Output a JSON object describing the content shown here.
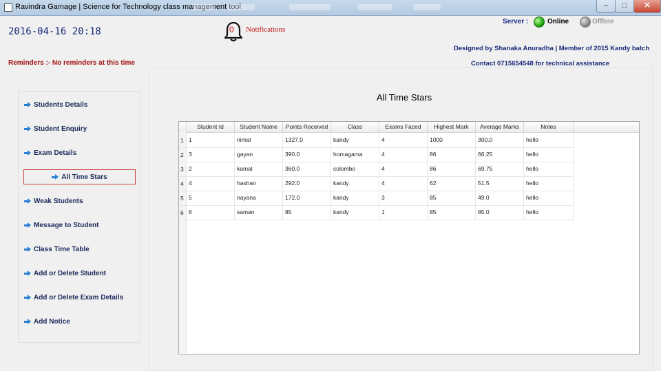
{
  "window": {
    "title": "Ravindra Gamage | Science for Technology class management tool",
    "min": "–",
    "max": "□",
    "close": "✕"
  },
  "header": {
    "datetime": "2016-04-16 20:18",
    "notifications": {
      "count": "0",
      "label": "Notifications",
      "icon": "bell-icon"
    },
    "server": {
      "label": "Server :",
      "online": "Online",
      "offline": "Offline",
      "state": "online",
      "online_color": "#22a80e",
      "offline_color": "#8c8c8c"
    },
    "designed_by": "Designed by Shanaka Anuradha | Member of 2015 Kandy  batch",
    "contact": "Contact 0715654548 for technical assistance",
    "reminders": "Reminders :- No reminders at this time"
  },
  "sidebar": {
    "items": [
      {
        "label": "Students Details"
      },
      {
        "label": "Student Enquiry"
      },
      {
        "label": "Exam Details"
      },
      {
        "label": "All Time Stars",
        "active": true
      },
      {
        "label": "Weak Students"
      },
      {
        "label": "Message to Student"
      },
      {
        "label": "Class Time Table"
      },
      {
        "label": "Add or Delete Student"
      },
      {
        "label": "Add or Delete Exam Details"
      },
      {
        "label": "Add Notice"
      }
    ]
  },
  "main": {
    "title": "All Time Stars",
    "table": {
      "columns": [
        "Student Id",
        "Student Name",
        "Points Received",
        "Class",
        "Exams Faced",
        "Highest Mark",
        "Average Marks",
        "Notes"
      ],
      "rows": [
        {
          "n": "1",
          "cells": [
            "1",
            "nimal",
            "1327.0",
            "kandy",
            "4",
            "1000",
            "300.0",
            "hello"
          ]
        },
        {
          "n": "2",
          "cells": [
            "3",
            "gayan",
            "390.0",
            "homagama",
            "4",
            "86",
            "66.25",
            "hello"
          ]
        },
        {
          "n": "3",
          "cells": [
            "2",
            "kamal",
            "360.0",
            "colombo",
            "4",
            "86",
            "69.75",
            "hello"
          ]
        },
        {
          "n": "4",
          "cells": [
            "4",
            "hashan",
            "292.0",
            "kandy",
            "4",
            "62",
            "51.5",
            "hello"
          ]
        },
        {
          "n": "5",
          "cells": [
            "5",
            "nayana",
            "172.0",
            "kandy",
            "3",
            "85",
            "49.0",
            "hello"
          ]
        },
        {
          "n": "6",
          "cells": [
            "6",
            "saman",
            "85",
            "kandy",
            "1",
            "85",
            "85.0",
            "hello"
          ]
        }
      ]
    }
  },
  "colors": {
    "accent": "#1a2a7a",
    "alert": "#a01010",
    "active_border": "#c84040",
    "arrow": "#2a7fd0"
  }
}
